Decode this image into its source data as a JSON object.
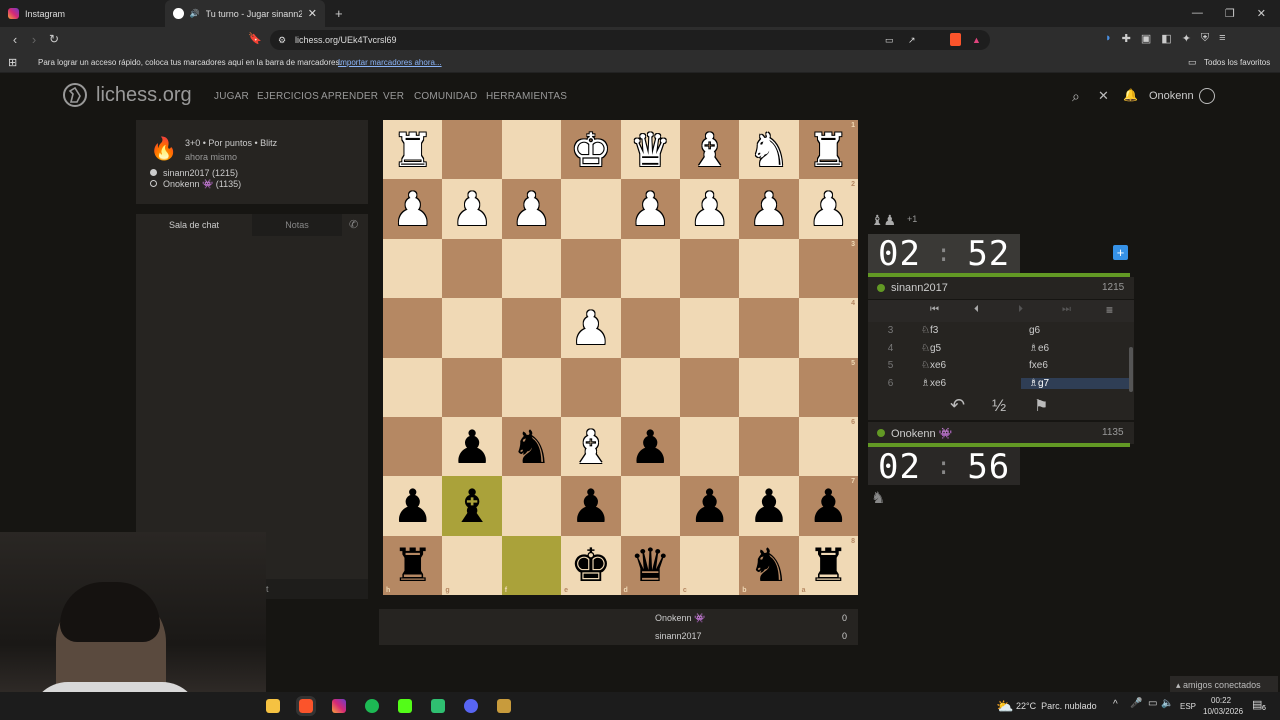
{
  "browser": {
    "tabs": [
      {
        "title": "Instagram",
        "active": false
      },
      {
        "title": "Tu turno - Jugar sinann2017",
        "active": true
      }
    ],
    "new_tab": "+",
    "url": "lichess.org/UEk4Tvcrsl69",
    "bookmarks_hint": "Para lograr un acceso rápido, coloca tus marcadores aquí en la barra de marcadores.",
    "bookmarks_link": "Importar marcadores ahora...",
    "all_favorites": "Todos los favoritos"
  },
  "header": {
    "logo": "lichess.org",
    "nav": [
      "JUGAR",
      "EJERCICIOS",
      "APRENDER",
      "VER",
      "COMUNIDAD",
      "HERRAMIENTAS"
    ],
    "user": "Onokenn"
  },
  "game_info": {
    "mode": "3+0 • Por puntos • Blitz",
    "time": "ahora mismo",
    "player1": "sinann2017 (1215)",
    "player2": "Onokenn 👾 (1135)"
  },
  "chat": {
    "tab_chat": "Sala de chat",
    "tab_notes": "Notas",
    "partial_text": "t"
  },
  "board": {
    "ranks": [
      "1",
      "2",
      "3",
      "4",
      "5",
      "6",
      "7",
      "8"
    ],
    "files": [
      "h",
      "g",
      "f",
      "e",
      "d",
      "c",
      "b",
      "a"
    ],
    "rows": [
      [
        "wR",
        "",
        "",
        "wK",
        "wQ",
        "wB",
        "wN",
        "wR"
      ],
      [
        "wP",
        "wP",
        "wP",
        "",
        "wP",
        "wP",
        "wP",
        "wP"
      ],
      [
        "",
        "",
        "",
        "",
        "",
        "",
        "",
        ""
      ],
      [
        "",
        "",
        "",
        "wP",
        "",
        "",
        "",
        ""
      ],
      [
        "",
        "",
        "",
        "",
        "",
        "",
        "",
        ""
      ],
      [
        "",
        "bP",
        "bN",
        "wB",
        "bP",
        "",
        "",
        ""
      ],
      [
        "bP",
        "bB",
        "",
        "bP",
        "",
        "bP",
        "bP",
        "bP"
      ],
      [
        "bR",
        "",
        "",
        "bK",
        "bQ",
        "",
        "bN",
        "bR"
      ]
    ],
    "highlighted": [
      "6,1",
      "7,2"
    ]
  },
  "opponent": {
    "captured_extra": "+1",
    "clock_min": "02",
    "clock_sec": "52",
    "name": "sinann2017",
    "rating": "1215"
  },
  "moves": [
    {
      "num": "3",
      "white": "♘f3",
      "black": "g6"
    },
    {
      "num": "4",
      "white": "♘g5",
      "black": "♗e6"
    },
    {
      "num": "5",
      "white": "♘xe6",
      "black": "fxe6"
    },
    {
      "num": "6",
      "white": "♗xe6",
      "black": "♗g7"
    }
  ],
  "controls": {
    "half": "½"
  },
  "me": {
    "name": "Onokenn 👾",
    "rating": "1135",
    "clock_min": "02",
    "clock_sec": "56"
  },
  "scores": [
    {
      "name": "Onokenn 👾",
      "score": "0"
    },
    {
      "name": "sinann2017",
      "score": "0"
    }
  ],
  "friends": "amigos conectados",
  "taskbar": {
    "weather": "22°C  Parc. nublado",
    "lang": "ESP",
    "time": "00:22",
    "date": "10/03/2026",
    "notif": "6"
  },
  "colors": {
    "light_square": "#f0d9b5",
    "dark_square": "#b58863",
    "highlight": "#aaa23a",
    "online_green": "#629924"
  }
}
